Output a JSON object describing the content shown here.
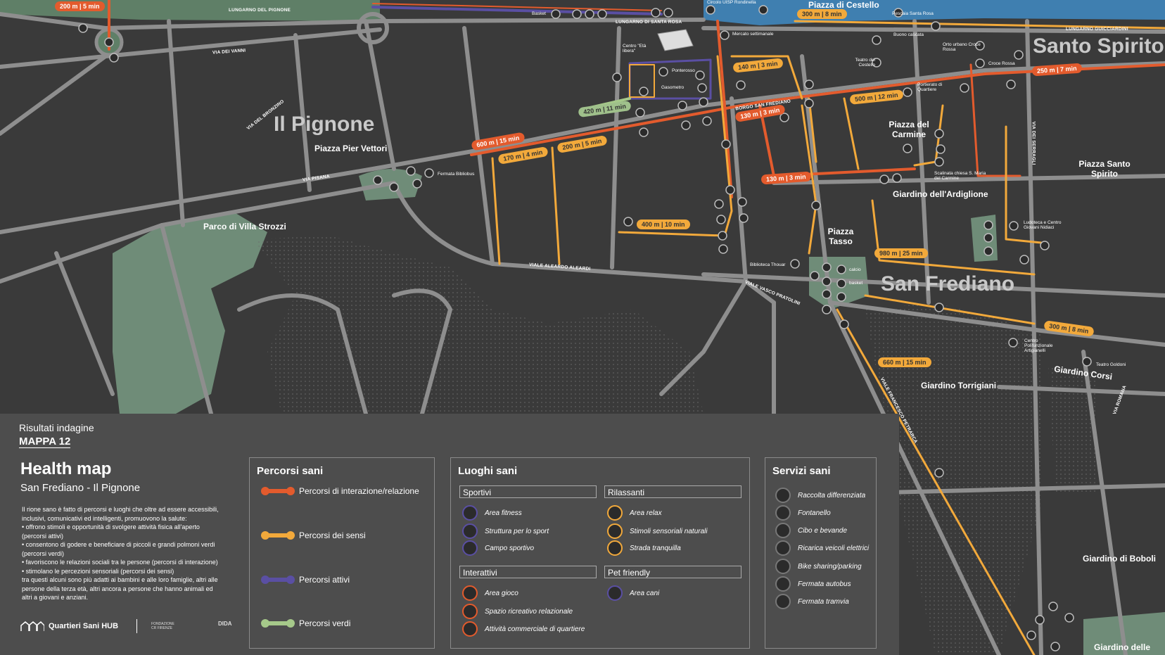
{
  "map": {
    "districts": {
      "pignone": "Il Pignone",
      "santo_spirito": "Santo Spirito",
      "san_frediano": "San Frediano"
    },
    "places": [
      "Piazza Pier Vettori",
      "Parco di Villa Strozzi",
      "Piazza del Carmine",
      "Giardino dell'Ardiglione",
      "Piazza Tasso",
      "Piazza Santo Spirito",
      "Giardino Torrigiani",
      "Giardino Corsi",
      "Giardino di Boboli",
      "Giardino delle",
      "Piazza di Cestello"
    ],
    "streets": [
      "LUNGARNO DEL PIGNONE",
      "VIA DEI VANNI",
      "VIA DEL BRONZINO",
      "VIA PISANA",
      "VIALE ALEARDO ALEARDI",
      "VIALE VASCO PRATOLINI",
      "BORGO SAN FREDIANO",
      "LUNGARNO DI SANTA ROSA",
      "LUNGARNO GUICCIARDINI",
      "VIA DEI SERRAGLI",
      "VIA ROMANA",
      "VIALE FRANCESCO PETRARCA"
    ],
    "small_labels": [
      "Fermata Bibliobus",
      "Basket",
      "Circolo UISP Rondinella",
      "Mercato settimanale",
      "Centro \"Età libera\"",
      "Ponterosso",
      "Gasometro",
      "Buono cascata",
      "Pescaia Santa Rosa",
      "Orto urbano Croce Rossa",
      "Croce Rossa",
      "Teatro del Cestello",
      "Portierato di Quartiere",
      "Scalinata chiesa S. Maria del Carmine",
      "Ludoteca e Centro Giovani Nidiaci",
      "Biblioteca Thouar",
      "calcio",
      "basket",
      "Centro Polifunzionale Artigianelli",
      "Teatro Goldoni"
    ],
    "distances": [
      "200 m | 5 min",
      "300 m | 8 min",
      "140 m | 3 min",
      "420 m | 11 min",
      "600 m | 15 min",
      "170 m | 4 min",
      "200 m | 5 min",
      "130 m | 3 min",
      "500 m | 12 min",
      "250 m | 7 min",
      "130 m | 3 min",
      "400 m | 10 min",
      "980 m | 25 min",
      "300 m | 8 min",
      "660 m | 15 min"
    ]
  },
  "legend": {
    "kicker": "Risultati indagine",
    "map_id": "MAPPA 12",
    "title": "Health map",
    "subtitle": "San Frediano - Il Pignone",
    "description": [
      "Il rione sano è fatto di percorsi e luoghi che oltre ad essere accessibili,",
      "inclusivi, comunicativi ed intelligenti, promuovono la salute:",
      "• offrono stimoli e opportunità di svolgere attività fisica all'aperto",
      "(percorsi attivi)",
      "• consentono di godere e beneficiare di piccoli e grandi polmoni verdi",
      "(percorsi verdi)",
      "• favoriscono le relazioni sociali tra le persone (percorsi di interazione)",
      "• stimolano le percezioni sensoriali (percorsi dei sensi)",
      "tra questi alcuni sono più adatti ai bambini e alle loro famiglie, altri alle",
      "persone della terza età, altri ancora a persone che hanno animali ed",
      "altri a giovani e anziani."
    ],
    "brand": "Quartieri Sani HUB",
    "partner_marks": [
      "FONDAZIONE CR FIRENZE",
      "DIDA"
    ],
    "percorsi": {
      "title": "Percorsi sani",
      "items": [
        {
          "label": "Percorsi di interazione/relazione",
          "color": "#e35b2d"
        },
        {
          "label": "Percorsi dei sensi",
          "color": "#f2a93b"
        },
        {
          "label": "Percorsi attivi",
          "color": "#5a4fa3"
        },
        {
          "label": "Percorsi verdi",
          "color": "#a6c98a"
        }
      ]
    },
    "luoghi": {
      "title": "Luoghi sani",
      "sportivi": {
        "title": "Sportivi",
        "items": [
          "Area fitness",
          "Struttura per lo sport",
          "Campo sportivo"
        ]
      },
      "rilassanti": {
        "title": "Rilassanti",
        "items": [
          "Area relax",
          "Stimoli sensoriali naturali",
          "Strada tranquilla"
        ]
      },
      "interattivi": {
        "title": "Interattivi",
        "items": [
          "Area gioco",
          "Spazio ricreativo relazionale",
          "Attività commerciale di quartiere"
        ]
      },
      "pet": {
        "title": "Pet friendly",
        "items": [
          "Area cani"
        ]
      }
    },
    "servizi": {
      "title": "Servizi sani",
      "items": [
        "Raccolta differenziata",
        "Fontanello",
        "Cibo e bevande",
        "Ricarica veicoli elettrici",
        "Bike sharing/parking",
        "Fermata autobus",
        "Fermata tramvia"
      ]
    }
  },
  "colors": {
    "interazione": "#e35b2d",
    "sensi": "#f2a93b",
    "attivi": "#5a4fa3",
    "verdi": "#a6c98a",
    "block": "#3a3a3a",
    "road": "#8e8e8e",
    "park": "#6f8c78",
    "river": "#3f7fb0"
  }
}
